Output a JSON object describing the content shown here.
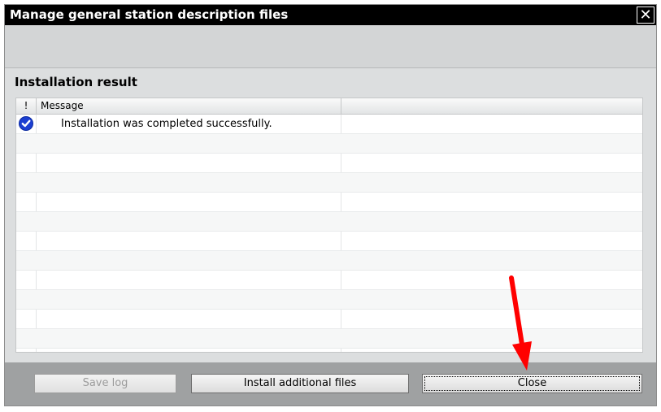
{
  "window": {
    "title": "Manage general station description files",
    "close_glyph": "✕"
  },
  "section": {
    "title": "Installation result"
  },
  "grid": {
    "headers": [
      "!",
      "Message",
      ""
    ],
    "rows": [
      {
        "icon": "success-check-icon",
        "message": "Installation was completed successfully."
      }
    ]
  },
  "buttons": {
    "save_log": "Save log",
    "install_additional": "Install additional files",
    "close": "Close"
  },
  "colors": {
    "titlebar": "#000000",
    "success_icon": "#1c3fd1",
    "annotation_arrow": "#ff0000"
  }
}
